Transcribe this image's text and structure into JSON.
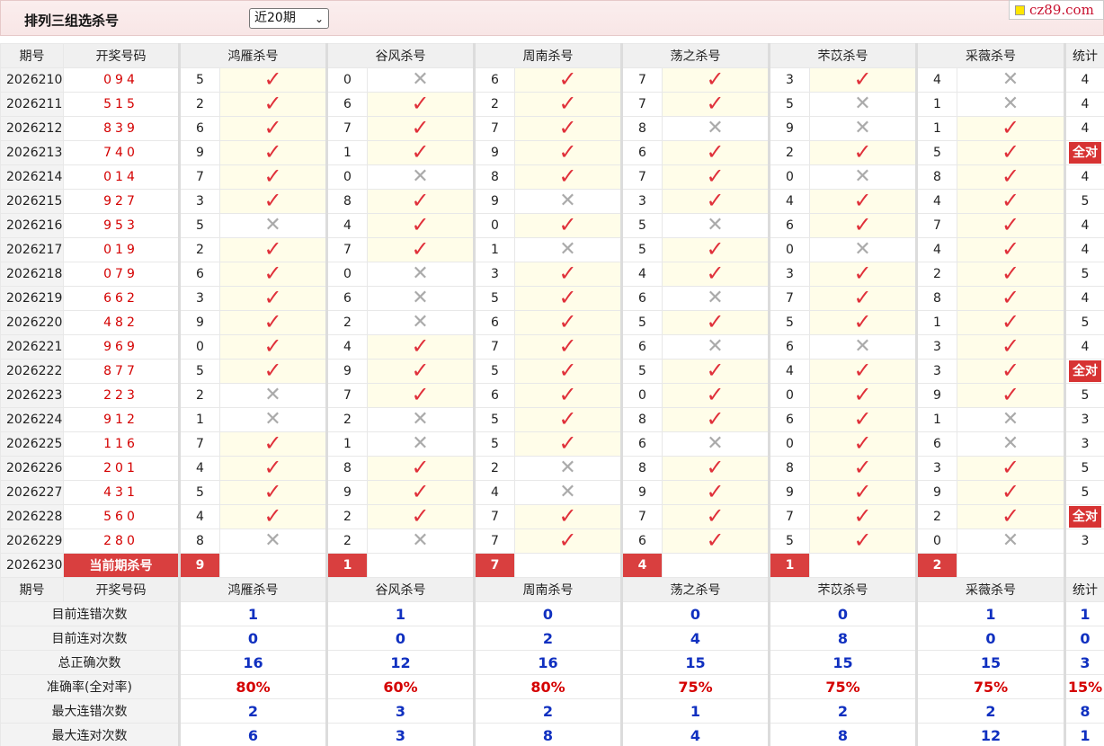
{
  "header": {
    "title": "排列三组选杀号",
    "period_select": "近20期",
    "site": "cz89.com"
  },
  "columns": {
    "issue": "期号",
    "draw": "开奖号码",
    "experts": [
      "鸿雁杀号",
      "谷风杀号",
      "周南杀号",
      "荡之杀号",
      "芣苡杀号",
      "采薇杀号"
    ],
    "stat": "统计"
  },
  "marks": {
    "hit": "✓",
    "miss": "✕"
  },
  "all_correct_label": "全对",
  "rows": [
    {
      "issue": "2026210",
      "draw": "094",
      "kills": [
        {
          "n": "5",
          "ok": true
        },
        {
          "n": "0",
          "ok": false
        },
        {
          "n": "6",
          "ok": true
        },
        {
          "n": "7",
          "ok": true
        },
        {
          "n": "3",
          "ok": true
        },
        {
          "n": "4",
          "ok": false
        }
      ],
      "stat": "4"
    },
    {
      "issue": "2026211",
      "draw": "515",
      "kills": [
        {
          "n": "2",
          "ok": true
        },
        {
          "n": "6",
          "ok": true
        },
        {
          "n": "2",
          "ok": true
        },
        {
          "n": "7",
          "ok": true
        },
        {
          "n": "5",
          "ok": false
        },
        {
          "n": "1",
          "ok": false
        }
      ],
      "stat": "4"
    },
    {
      "issue": "2026212",
      "draw": "839",
      "kills": [
        {
          "n": "6",
          "ok": true
        },
        {
          "n": "7",
          "ok": true
        },
        {
          "n": "7",
          "ok": true
        },
        {
          "n": "8",
          "ok": false
        },
        {
          "n": "9",
          "ok": false
        },
        {
          "n": "1",
          "ok": true
        }
      ],
      "stat": "4"
    },
    {
      "issue": "2026213",
      "draw": "740",
      "kills": [
        {
          "n": "9",
          "ok": true
        },
        {
          "n": "1",
          "ok": true
        },
        {
          "n": "9",
          "ok": true
        },
        {
          "n": "6",
          "ok": true
        },
        {
          "n": "2",
          "ok": true
        },
        {
          "n": "5",
          "ok": true
        }
      ],
      "stat": "全对"
    },
    {
      "issue": "2026214",
      "draw": "014",
      "kills": [
        {
          "n": "7",
          "ok": true
        },
        {
          "n": "0",
          "ok": false
        },
        {
          "n": "8",
          "ok": true
        },
        {
          "n": "7",
          "ok": true
        },
        {
          "n": "0",
          "ok": false
        },
        {
          "n": "8",
          "ok": true
        }
      ],
      "stat": "4"
    },
    {
      "issue": "2026215",
      "draw": "927",
      "kills": [
        {
          "n": "3",
          "ok": true
        },
        {
          "n": "8",
          "ok": true
        },
        {
          "n": "9",
          "ok": false
        },
        {
          "n": "3",
          "ok": true
        },
        {
          "n": "4",
          "ok": true
        },
        {
          "n": "4",
          "ok": true
        }
      ],
      "stat": "5"
    },
    {
      "issue": "2026216",
      "draw": "953",
      "kills": [
        {
          "n": "5",
          "ok": false
        },
        {
          "n": "4",
          "ok": true
        },
        {
          "n": "0",
          "ok": true
        },
        {
          "n": "5",
          "ok": false
        },
        {
          "n": "6",
          "ok": true
        },
        {
          "n": "7",
          "ok": true
        }
      ],
      "stat": "4"
    },
    {
      "issue": "2026217",
      "draw": "019",
      "kills": [
        {
          "n": "2",
          "ok": true
        },
        {
          "n": "7",
          "ok": true
        },
        {
          "n": "1",
          "ok": false
        },
        {
          "n": "5",
          "ok": true
        },
        {
          "n": "0",
          "ok": false
        },
        {
          "n": "4",
          "ok": true
        }
      ],
      "stat": "4"
    },
    {
      "issue": "2026218",
      "draw": "079",
      "kills": [
        {
          "n": "6",
          "ok": true
        },
        {
          "n": "0",
          "ok": false
        },
        {
          "n": "3",
          "ok": true
        },
        {
          "n": "4",
          "ok": true
        },
        {
          "n": "3",
          "ok": true
        },
        {
          "n": "2",
          "ok": true
        }
      ],
      "stat": "5"
    },
    {
      "issue": "2026219",
      "draw": "662",
      "kills": [
        {
          "n": "3",
          "ok": true
        },
        {
          "n": "6",
          "ok": false
        },
        {
          "n": "5",
          "ok": true
        },
        {
          "n": "6",
          "ok": false
        },
        {
          "n": "7",
          "ok": true
        },
        {
          "n": "8",
          "ok": true
        }
      ],
      "stat": "4"
    },
    {
      "issue": "2026220",
      "draw": "482",
      "kills": [
        {
          "n": "9",
          "ok": true
        },
        {
          "n": "2",
          "ok": false
        },
        {
          "n": "6",
          "ok": true
        },
        {
          "n": "5",
          "ok": true
        },
        {
          "n": "5",
          "ok": true
        },
        {
          "n": "1",
          "ok": true
        }
      ],
      "stat": "5"
    },
    {
      "issue": "2026221",
      "draw": "969",
      "kills": [
        {
          "n": "0",
          "ok": true
        },
        {
          "n": "4",
          "ok": true
        },
        {
          "n": "7",
          "ok": true
        },
        {
          "n": "6",
          "ok": false
        },
        {
          "n": "6",
          "ok": false
        },
        {
          "n": "3",
          "ok": true
        }
      ],
      "stat": "4"
    },
    {
      "issue": "2026222",
      "draw": "877",
      "kills": [
        {
          "n": "5",
          "ok": true
        },
        {
          "n": "9",
          "ok": true
        },
        {
          "n": "5",
          "ok": true
        },
        {
          "n": "5",
          "ok": true
        },
        {
          "n": "4",
          "ok": true
        },
        {
          "n": "3",
          "ok": true
        }
      ],
      "stat": "全对"
    },
    {
      "issue": "2026223",
      "draw": "223",
      "kills": [
        {
          "n": "2",
          "ok": false
        },
        {
          "n": "7",
          "ok": true
        },
        {
          "n": "6",
          "ok": true
        },
        {
          "n": "0",
          "ok": true
        },
        {
          "n": "0",
          "ok": true
        },
        {
          "n": "9",
          "ok": true
        }
      ],
      "stat": "5"
    },
    {
      "issue": "2026224",
      "draw": "912",
      "kills": [
        {
          "n": "1",
          "ok": false
        },
        {
          "n": "2",
          "ok": false
        },
        {
          "n": "5",
          "ok": true
        },
        {
          "n": "8",
          "ok": true
        },
        {
          "n": "6",
          "ok": true
        },
        {
          "n": "1",
          "ok": false
        }
      ],
      "stat": "3"
    },
    {
      "issue": "2026225",
      "draw": "116",
      "kills": [
        {
          "n": "7",
          "ok": true
        },
        {
          "n": "1",
          "ok": false
        },
        {
          "n": "5",
          "ok": true
        },
        {
          "n": "6",
          "ok": false
        },
        {
          "n": "0",
          "ok": true
        },
        {
          "n": "6",
          "ok": false
        }
      ],
      "stat": "3"
    },
    {
      "issue": "2026226",
      "draw": "201",
      "kills": [
        {
          "n": "4",
          "ok": true
        },
        {
          "n": "8",
          "ok": true
        },
        {
          "n": "2",
          "ok": false
        },
        {
          "n": "8",
          "ok": true
        },
        {
          "n": "8",
          "ok": true
        },
        {
          "n": "3",
          "ok": true
        }
      ],
      "stat": "5"
    },
    {
      "issue": "2026227",
      "draw": "431",
      "kills": [
        {
          "n": "5",
          "ok": true
        },
        {
          "n": "9",
          "ok": true
        },
        {
          "n": "4",
          "ok": false
        },
        {
          "n": "9",
          "ok": true
        },
        {
          "n": "9",
          "ok": true
        },
        {
          "n": "9",
          "ok": true
        }
      ],
      "stat": "5"
    },
    {
      "issue": "2026228",
      "draw": "560",
      "kills": [
        {
          "n": "4",
          "ok": true
        },
        {
          "n": "2",
          "ok": true
        },
        {
          "n": "7",
          "ok": true
        },
        {
          "n": "7",
          "ok": true
        },
        {
          "n": "7",
          "ok": true
        },
        {
          "n": "2",
          "ok": true
        }
      ],
      "stat": "全对"
    },
    {
      "issue": "2026229",
      "draw": "280",
      "kills": [
        {
          "n": "8",
          "ok": false
        },
        {
          "n": "2",
          "ok": false
        },
        {
          "n": "7",
          "ok": true
        },
        {
          "n": "6",
          "ok": true
        },
        {
          "n": "5",
          "ok": true
        },
        {
          "n": "0",
          "ok": false
        }
      ],
      "stat": "3"
    }
  ],
  "current": {
    "issue": "2026230",
    "label": "当前期杀号",
    "kills": [
      "9",
      "1",
      "7",
      "4",
      "1",
      "2"
    ]
  },
  "stats": [
    {
      "label": "目前连错次数",
      "values": [
        "1",
        "1",
        "0",
        "0",
        "0",
        "1"
      ],
      "total": "1",
      "style": "blue"
    },
    {
      "label": "目前连对次数",
      "values": [
        "0",
        "0",
        "2",
        "4",
        "8",
        "0"
      ],
      "total": "0",
      "style": "blue"
    },
    {
      "label": "总正确次数",
      "values": [
        "16",
        "12",
        "16",
        "15",
        "15",
        "15"
      ],
      "total": "3",
      "style": "blue"
    },
    {
      "label": "准确率(全对率)",
      "values": [
        "80%",
        "60%",
        "80%",
        "75%",
        "75%",
        "75%"
      ],
      "total": "15%",
      "style": "red"
    },
    {
      "label": "最大连错次数",
      "values": [
        "2",
        "3",
        "2",
        "1",
        "2",
        "2"
      ],
      "total": "8",
      "style": "blue"
    },
    {
      "label": "最大连对次数",
      "values": [
        "6",
        "3",
        "8",
        "4",
        "8",
        "12"
      ],
      "total": "1",
      "style": "blue"
    }
  ]
}
